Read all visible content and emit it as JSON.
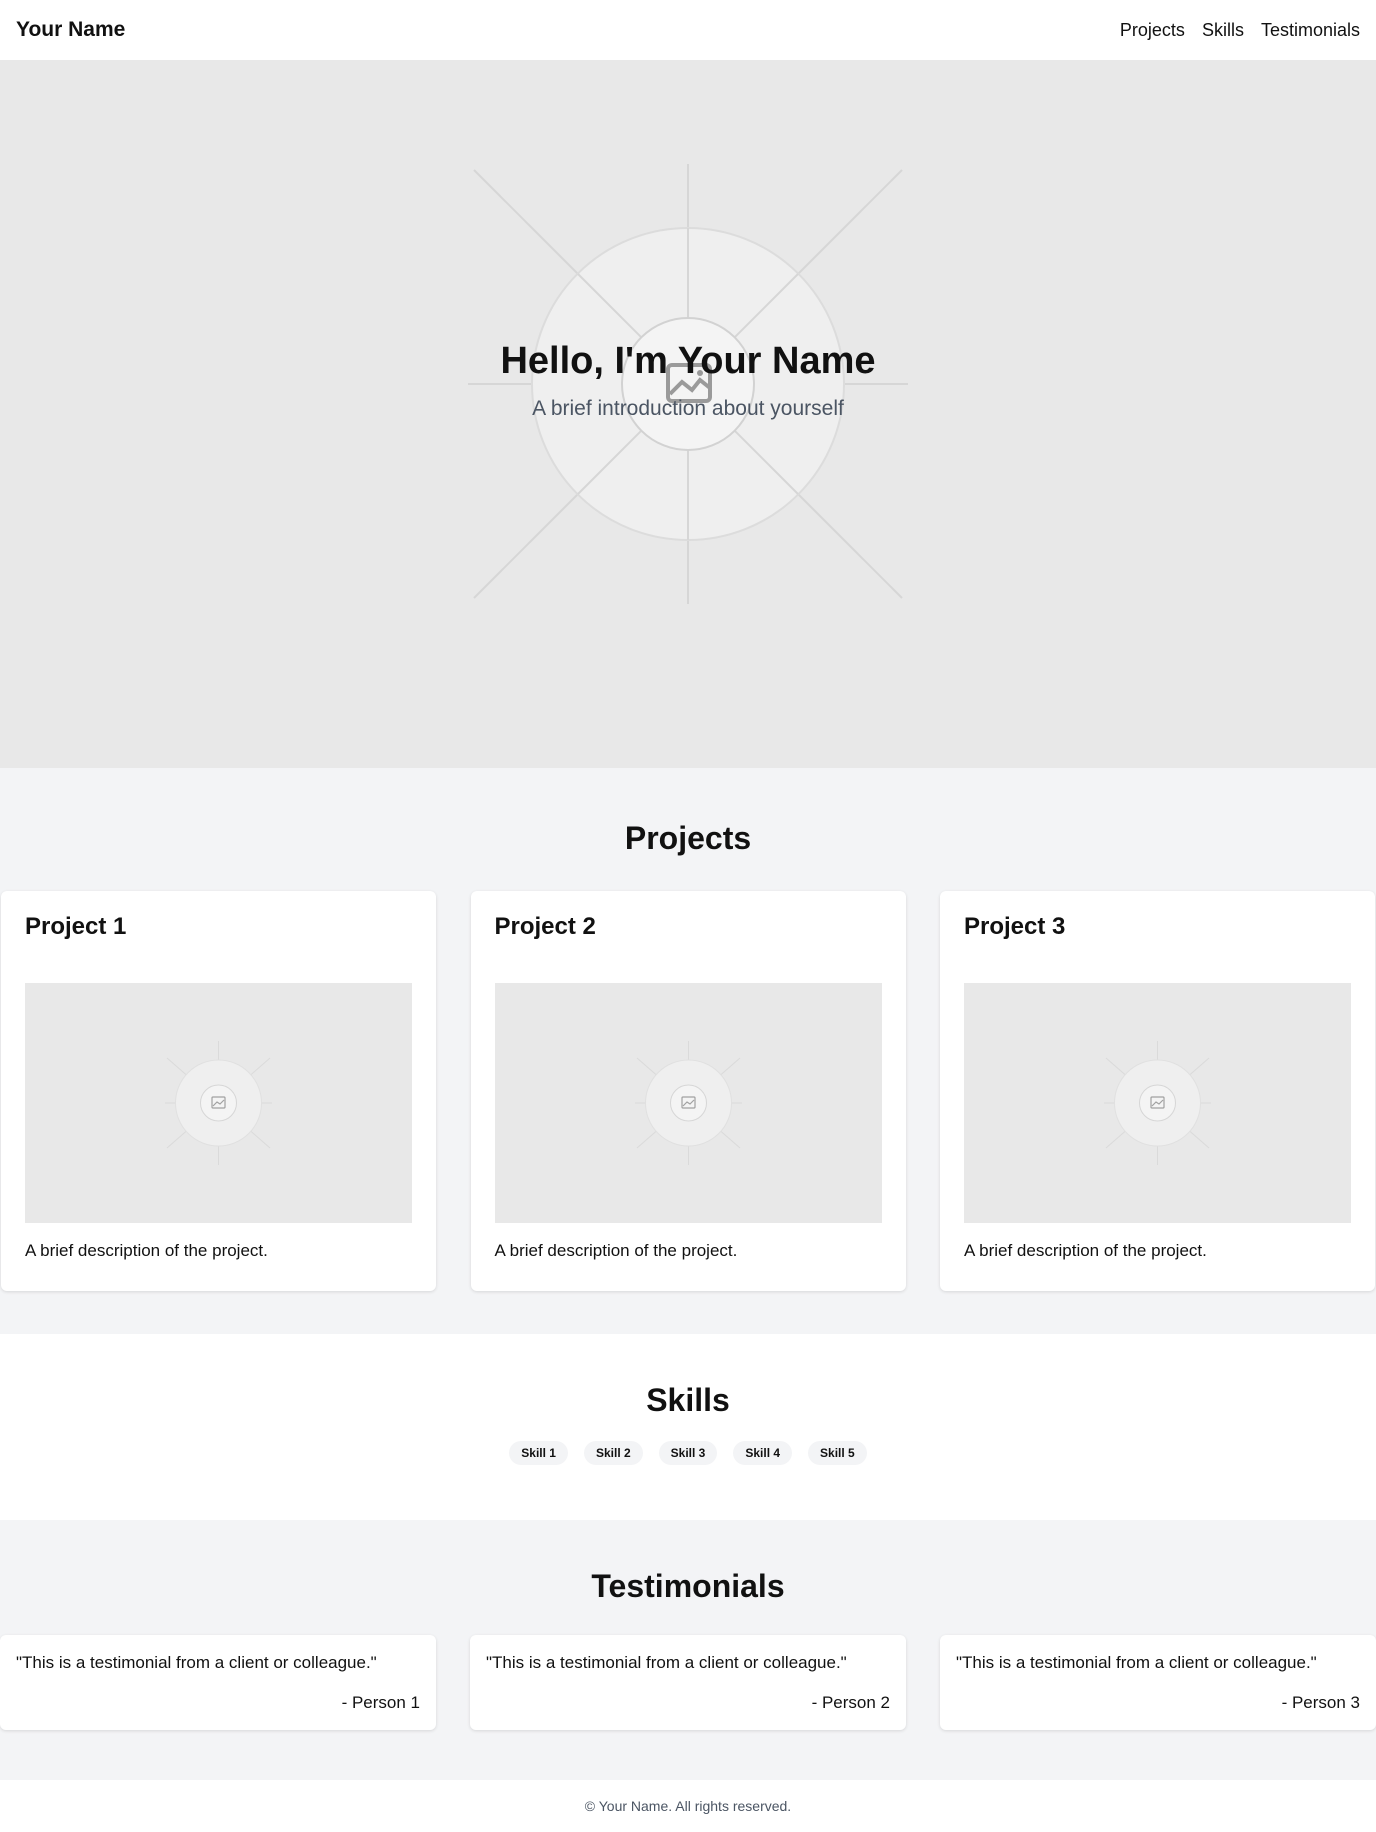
{
  "header": {
    "brand": "Your Name",
    "nav": [
      {
        "label": "Projects"
      },
      {
        "label": "Skills"
      },
      {
        "label": "Testimonials"
      }
    ]
  },
  "hero": {
    "title": "Hello, I'm Your Name",
    "subtitle": "A brief introduction about yourself",
    "background_icon": "image-placeholder-icon"
  },
  "projects": {
    "title": "Projects",
    "items": [
      {
        "title": "Project 1",
        "description": "A brief description of the project.",
        "image_icon": "image-placeholder-icon"
      },
      {
        "title": "Project 2",
        "description": "A brief description of the project.",
        "image_icon": "image-placeholder-icon"
      },
      {
        "title": "Project 3",
        "description": "A brief description of the project.",
        "image_icon": "image-placeholder-icon"
      }
    ]
  },
  "skills": {
    "title": "Skills",
    "items": [
      {
        "label": "Skill 1"
      },
      {
        "label": "Skill 2"
      },
      {
        "label": "Skill 3"
      },
      {
        "label": "Skill 4"
      },
      {
        "label": "Skill 5"
      }
    ]
  },
  "testimonials": {
    "title": "Testimonials",
    "items": [
      {
        "quote": "\"This is a testimonial from a client or colleague.\"",
        "author": "- Person 1"
      },
      {
        "quote": "\"This is a testimonial from a client or colleague.\"",
        "author": "- Person 2"
      },
      {
        "quote": "\"This is a testimonial from a client or colleague.\"",
        "author": "- Person 3"
      }
    ]
  },
  "footer": {
    "text": "© Your Name. All rights reserved."
  },
  "colors": {
    "page_bg": "#ffffff",
    "section_alt_bg": "#f3f4f6",
    "placeholder_bg": "#e8e8e8",
    "text_primary": "#111111",
    "text_muted": "#4b5563"
  }
}
